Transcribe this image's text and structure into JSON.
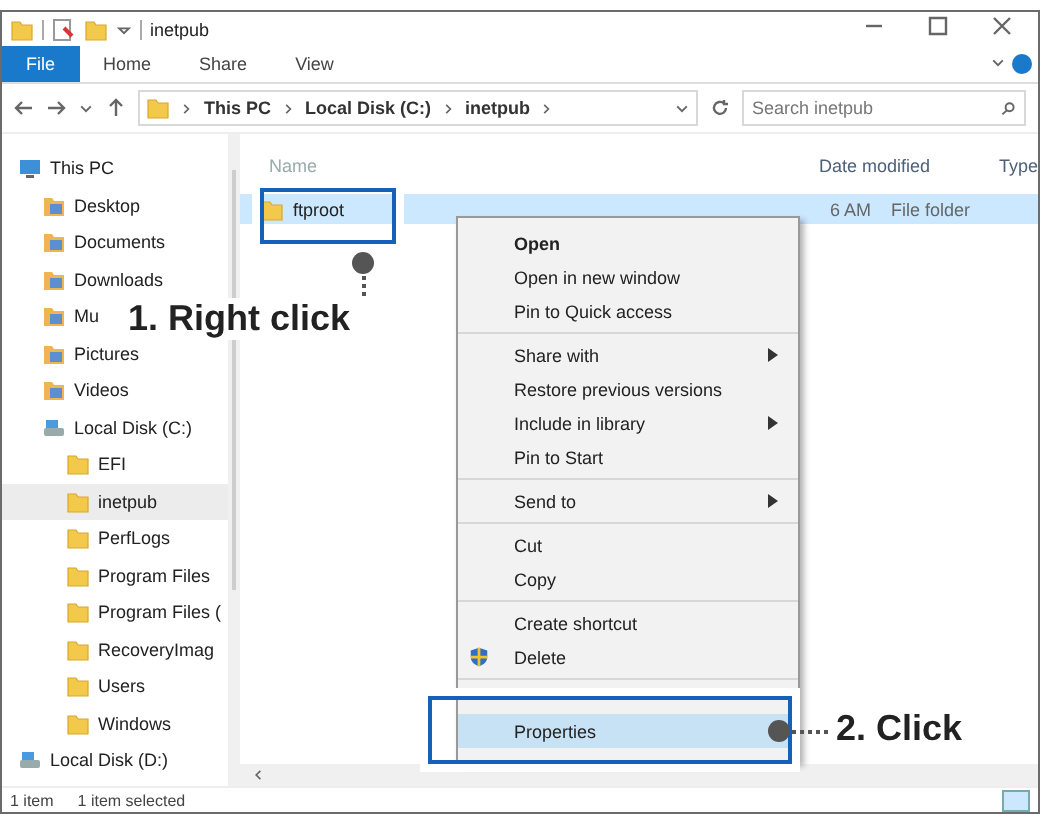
{
  "window": {
    "title": "inetpub"
  },
  "ribbon_tabs": [
    {
      "label": "File",
      "selected": true
    },
    {
      "label": "Home",
      "selected": false
    },
    {
      "label": "Share",
      "selected": false
    },
    {
      "label": "View",
      "selected": false
    }
  ],
  "address_bar": {
    "path": [
      "This PC",
      "Local Disk (C:)",
      "inetpub"
    ]
  },
  "search": {
    "placeholder": "Search inetpub"
  },
  "sidebar": {
    "items": [
      {
        "label": "This PC",
        "kind": "computer",
        "selected": false,
        "children": [
          {
            "label": "Desktop",
            "kind": "library",
            "selected": false
          },
          {
            "label": "Documents",
            "kind": "library",
            "selected": false
          },
          {
            "label": "Downloads",
            "kind": "library",
            "selected": false
          },
          {
            "label": "Mu",
            "kind": "library",
            "selected": false
          },
          {
            "label": "Pictures",
            "kind": "library",
            "selected": false
          },
          {
            "label": "Videos",
            "kind": "library",
            "selected": false
          },
          {
            "label": "Local Disk (C:)",
            "kind": "drive",
            "selected": false,
            "children": [
              {
                "label": "EFI",
                "kind": "folder",
                "selected": false
              },
              {
                "label": "inetpub",
                "kind": "folder",
                "selected": true
              },
              {
                "label": "PerfLogs",
                "kind": "folder",
                "selected": false
              },
              {
                "label": "Program Files",
                "kind": "folder",
                "selected": false
              },
              {
                "label": "Program Files (",
                "kind": "folder",
                "selected": false
              },
              {
                "label": "RecoveryImag",
                "kind": "folder",
                "selected": false
              },
              {
                "label": "Users",
                "kind": "folder",
                "selected": false
              },
              {
                "label": "Windows",
                "kind": "folder",
                "selected": false
              }
            ]
          }
        ]
      },
      {
        "label": "Local Disk (D:)",
        "kind": "drive",
        "selected": false
      }
    ]
  },
  "file_list": {
    "columns": [
      "Name",
      "Date modified",
      "Type"
    ],
    "rows": [
      {
        "name": "ftproot",
        "date_modified": "6 AM",
        "type": "File folder",
        "selected": true
      }
    ]
  },
  "context_menu": {
    "groups": [
      [
        {
          "label": "Open",
          "kind": "default",
          "submenu": false
        },
        {
          "label": "Open in new window",
          "kind": "plain",
          "submenu": false
        },
        {
          "label": "Pin to Quick access",
          "kind": "plain",
          "submenu": false
        }
      ],
      [
        {
          "label": "Share with",
          "kind": "plain",
          "submenu": true
        },
        {
          "label": "Restore previous versions",
          "kind": "plain",
          "submenu": false
        },
        {
          "label": "Include in library",
          "kind": "plain",
          "submenu": true
        },
        {
          "label": "Pin to Start",
          "kind": "plain",
          "submenu": false
        }
      ],
      [
        {
          "label": "Send to",
          "kind": "plain",
          "submenu": true
        }
      ],
      [
        {
          "label": "Cut",
          "kind": "plain",
          "submenu": false
        },
        {
          "label": "Copy",
          "kind": "plain",
          "submenu": false
        }
      ],
      [
        {
          "label": "Create shortcut",
          "kind": "plain",
          "submenu": false
        },
        {
          "label": "Delete",
          "kind": "admin",
          "submenu": false
        }
      ]
    ],
    "highlighted": {
      "label": "Properties",
      "selected": true
    }
  },
  "annotations": [
    {
      "label": "1. Right click"
    },
    {
      "label": "2. Click"
    }
  ],
  "status_bar": {
    "count": "1 item",
    "selection": "1 item selected"
  }
}
